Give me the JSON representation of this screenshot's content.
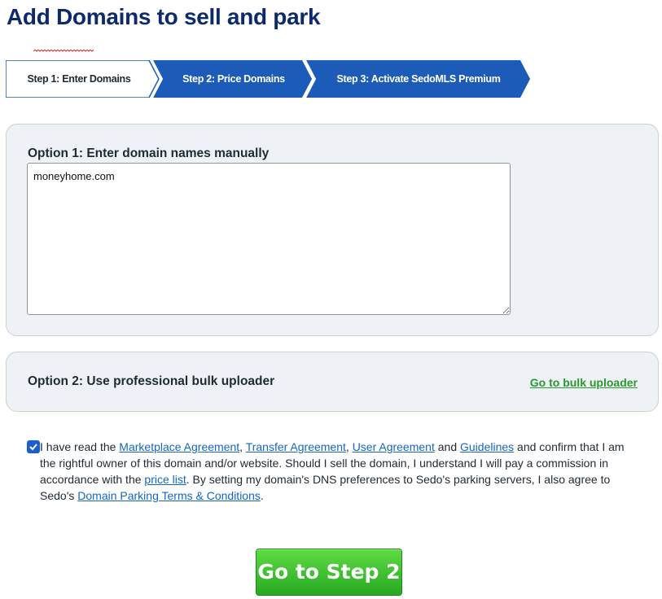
{
  "page": {
    "title": "Add Domains to sell and park"
  },
  "steps": [
    {
      "label": "Step 1: Enter Domains",
      "active": true
    },
    {
      "label": "Step 2: Price Domains",
      "active": false
    },
    {
      "label": "Step 3: Activate SedoMLS Premium",
      "active": false
    }
  ],
  "option1": {
    "title": "Option 1: Enter domain names manually",
    "value": "moneyhome.com"
  },
  "option2": {
    "title": "Option 2: Use professional bulk uploader",
    "link": "Go to bulk uploader"
  },
  "agreement": {
    "checked": true,
    "t1": "I have read the ",
    "link_marketplace": "Marketplace Agreement",
    "t2": ", ",
    "link_transfer": "Transfer Agreement",
    "t3": ", ",
    "link_user": "User Agreement",
    "t4": " and ",
    "link_guidelines": "Guidelines",
    "t5": " and confirm that I am the rightful owner of this domain and/or website. Should I sell the domain, I understand I will pay a commission in accordance with the ",
    "link_price": "price list",
    "t6": ". By setting my domain's DNS preferences to Sedo's parking servers, I also agree to Sedo's ",
    "link_parking": "Domain Parking Terms & Conditions",
    "t7": "."
  },
  "button": {
    "label": "Go to Step 2"
  },
  "colors": {
    "title": "#0d2a6b",
    "step_active_bg": "#ffffff",
    "step_inactive_bg": "#1c5cb8",
    "panel_bg": "#eef2f7",
    "link": "#1566c0",
    "bulk_link": "#2a9a2a",
    "button": "#33b52b"
  }
}
